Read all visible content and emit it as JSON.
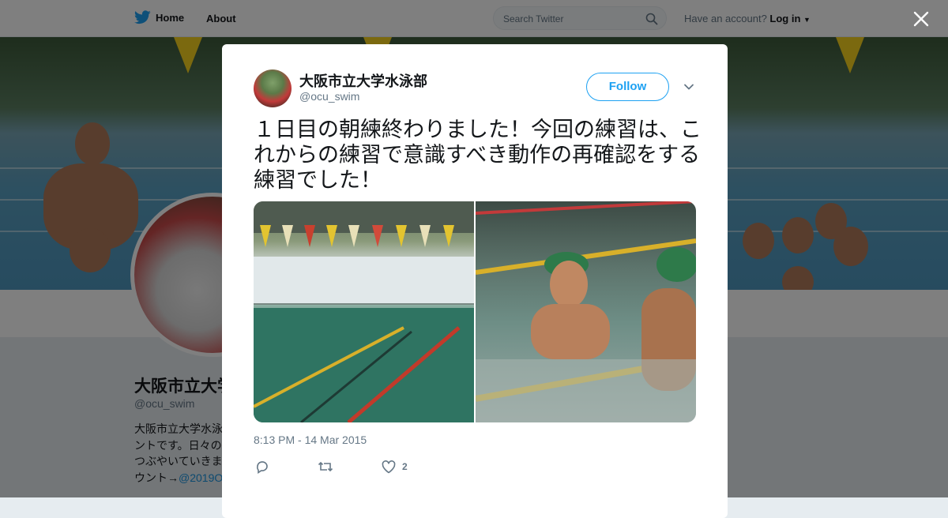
{
  "nav": {
    "home_label": "Home",
    "about_label": "About",
    "search_placeholder": "Search Twitter",
    "have_account": "Have an account?",
    "login_label": "Log in"
  },
  "profile": {
    "name": "大阪市立大学水泳部",
    "name_partial": "大阪市立大学",
    "handle": "@ocu_swim",
    "bio_lines": [
      "大阪市立大学水泳",
      "ントです。日々の",
      "つぶやいていきま",
      "ウント→"
    ],
    "bio_link": "@2019O"
  },
  "tweet": {
    "name": "大阪市立大学水泳部",
    "handle": "@ocu_swim",
    "follow_label": "Follow",
    "text": "１日目の朝練終わりました！今回の練習は、これからの練習で意識すべき動作の再確認をする練習でした！",
    "timestamp": "8:13 PM - 14 Mar 2015",
    "like_count": "2"
  },
  "icons": {
    "logo": "twitter-bird-icon",
    "search": "search-icon",
    "close": "close-icon",
    "caret": "chevron-down-icon",
    "reply": "reply-icon",
    "retweet": "retweet-icon",
    "like": "heart-icon"
  },
  "colors": {
    "brand_blue": "#1da1f2",
    "text_primary": "#14171a",
    "text_secondary": "#657786"
  }
}
